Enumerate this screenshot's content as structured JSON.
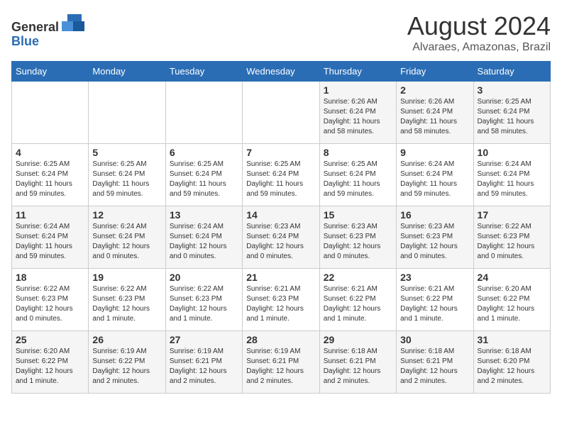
{
  "header": {
    "logo_line1": "General",
    "logo_line2": "Blue",
    "month_title": "August 2024",
    "location": "Alvaraes, Amazonas, Brazil"
  },
  "weekdays": [
    "Sunday",
    "Monday",
    "Tuesday",
    "Wednesday",
    "Thursday",
    "Friday",
    "Saturday"
  ],
  "weeks": [
    [
      {
        "day": "",
        "info": ""
      },
      {
        "day": "",
        "info": ""
      },
      {
        "day": "",
        "info": ""
      },
      {
        "day": "",
        "info": ""
      },
      {
        "day": "1",
        "info": "Sunrise: 6:26 AM\nSunset: 6:24 PM\nDaylight: 11 hours\nand 58 minutes."
      },
      {
        "day": "2",
        "info": "Sunrise: 6:26 AM\nSunset: 6:24 PM\nDaylight: 11 hours\nand 58 minutes."
      },
      {
        "day": "3",
        "info": "Sunrise: 6:25 AM\nSunset: 6:24 PM\nDaylight: 11 hours\nand 58 minutes."
      }
    ],
    [
      {
        "day": "4",
        "info": "Sunrise: 6:25 AM\nSunset: 6:24 PM\nDaylight: 11 hours\nand 59 minutes."
      },
      {
        "day": "5",
        "info": "Sunrise: 6:25 AM\nSunset: 6:24 PM\nDaylight: 11 hours\nand 59 minutes."
      },
      {
        "day": "6",
        "info": "Sunrise: 6:25 AM\nSunset: 6:24 PM\nDaylight: 11 hours\nand 59 minutes."
      },
      {
        "day": "7",
        "info": "Sunrise: 6:25 AM\nSunset: 6:24 PM\nDaylight: 11 hours\nand 59 minutes."
      },
      {
        "day": "8",
        "info": "Sunrise: 6:25 AM\nSunset: 6:24 PM\nDaylight: 11 hours\nand 59 minutes."
      },
      {
        "day": "9",
        "info": "Sunrise: 6:24 AM\nSunset: 6:24 PM\nDaylight: 11 hours\nand 59 minutes."
      },
      {
        "day": "10",
        "info": "Sunrise: 6:24 AM\nSunset: 6:24 PM\nDaylight: 11 hours\nand 59 minutes."
      }
    ],
    [
      {
        "day": "11",
        "info": "Sunrise: 6:24 AM\nSunset: 6:24 PM\nDaylight: 11 hours\nand 59 minutes."
      },
      {
        "day": "12",
        "info": "Sunrise: 6:24 AM\nSunset: 6:24 PM\nDaylight: 12 hours\nand 0 minutes."
      },
      {
        "day": "13",
        "info": "Sunrise: 6:24 AM\nSunset: 6:24 PM\nDaylight: 12 hours\nand 0 minutes."
      },
      {
        "day": "14",
        "info": "Sunrise: 6:23 AM\nSunset: 6:24 PM\nDaylight: 12 hours\nand 0 minutes."
      },
      {
        "day": "15",
        "info": "Sunrise: 6:23 AM\nSunset: 6:23 PM\nDaylight: 12 hours\nand 0 minutes."
      },
      {
        "day": "16",
        "info": "Sunrise: 6:23 AM\nSunset: 6:23 PM\nDaylight: 12 hours\nand 0 minutes."
      },
      {
        "day": "17",
        "info": "Sunrise: 6:22 AM\nSunset: 6:23 PM\nDaylight: 12 hours\nand 0 minutes."
      }
    ],
    [
      {
        "day": "18",
        "info": "Sunrise: 6:22 AM\nSunset: 6:23 PM\nDaylight: 12 hours\nand 0 minutes."
      },
      {
        "day": "19",
        "info": "Sunrise: 6:22 AM\nSunset: 6:23 PM\nDaylight: 12 hours\nand 1 minute."
      },
      {
        "day": "20",
        "info": "Sunrise: 6:22 AM\nSunset: 6:23 PM\nDaylight: 12 hours\nand 1 minute."
      },
      {
        "day": "21",
        "info": "Sunrise: 6:21 AM\nSunset: 6:23 PM\nDaylight: 12 hours\nand 1 minute."
      },
      {
        "day": "22",
        "info": "Sunrise: 6:21 AM\nSunset: 6:22 PM\nDaylight: 12 hours\nand 1 minute."
      },
      {
        "day": "23",
        "info": "Sunrise: 6:21 AM\nSunset: 6:22 PM\nDaylight: 12 hours\nand 1 minute."
      },
      {
        "day": "24",
        "info": "Sunrise: 6:20 AM\nSunset: 6:22 PM\nDaylight: 12 hours\nand 1 minute."
      }
    ],
    [
      {
        "day": "25",
        "info": "Sunrise: 6:20 AM\nSunset: 6:22 PM\nDaylight: 12 hours\nand 1 minute."
      },
      {
        "day": "26",
        "info": "Sunrise: 6:19 AM\nSunset: 6:22 PM\nDaylight: 12 hours\nand 2 minutes."
      },
      {
        "day": "27",
        "info": "Sunrise: 6:19 AM\nSunset: 6:21 PM\nDaylight: 12 hours\nand 2 minutes."
      },
      {
        "day": "28",
        "info": "Sunrise: 6:19 AM\nSunset: 6:21 PM\nDaylight: 12 hours\nand 2 minutes."
      },
      {
        "day": "29",
        "info": "Sunrise: 6:18 AM\nSunset: 6:21 PM\nDaylight: 12 hours\nand 2 minutes."
      },
      {
        "day": "30",
        "info": "Sunrise: 6:18 AM\nSunset: 6:21 PM\nDaylight: 12 hours\nand 2 minutes."
      },
      {
        "day": "31",
        "info": "Sunrise: 6:18 AM\nSunset: 6:20 PM\nDaylight: 12 hours\nand 2 minutes."
      }
    ]
  ]
}
